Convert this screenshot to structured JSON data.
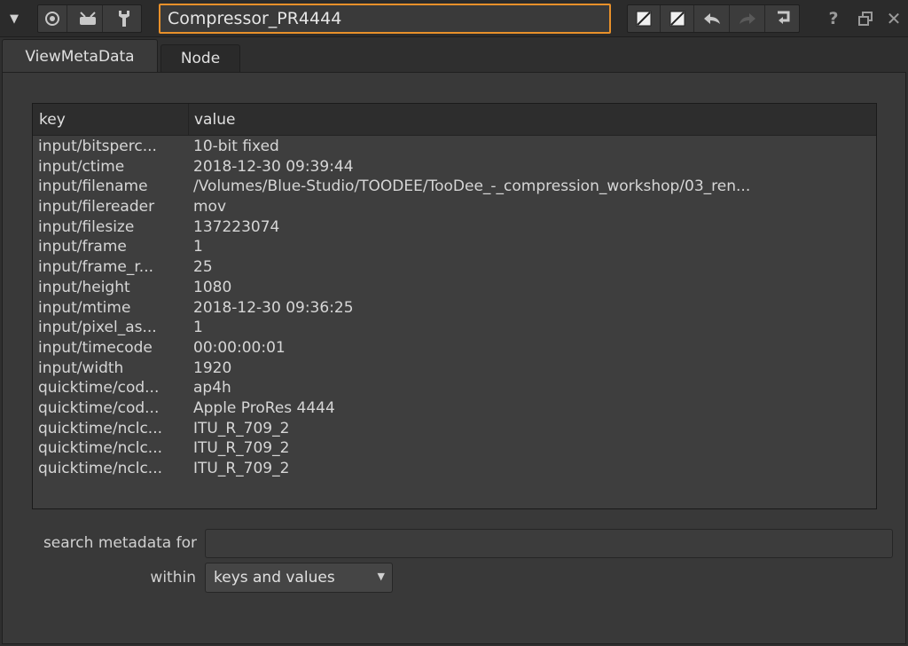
{
  "titlebar": {
    "node_name": "Compressor_PR4444",
    "collapse_icon": "triangle-down-icon",
    "left_tools": [
      "center-dot-icon",
      "viewer-icon",
      "settings-icon"
    ],
    "right_tools": [
      "input-swatch-icon",
      "output-swatch-icon",
      "undo-icon",
      "redo-icon",
      "revert-icon"
    ],
    "help_label": "?",
    "float_icon": "float-window-icon",
    "close_label": "✕"
  },
  "tabs": [
    {
      "label": "ViewMetaData",
      "active": true
    },
    {
      "label": "Node",
      "active": false
    }
  ],
  "table": {
    "headers": {
      "key": "key",
      "value": "value"
    },
    "rows": [
      {
        "key": "input/bitsperc...",
        "value": "10-bit fixed"
      },
      {
        "key": "input/ctime",
        "value": "2018-12-30 09:39:44"
      },
      {
        "key": "input/filename",
        "value": "/Volumes/Blue-Studio/TOODEE/TooDee_-_compression_workshop/03_ren..."
      },
      {
        "key": "input/filereader",
        "value": "mov"
      },
      {
        "key": "input/filesize",
        "value": "137223074"
      },
      {
        "key": "input/frame",
        "value": "1"
      },
      {
        "key": "input/frame_r...",
        "value": "25"
      },
      {
        "key": "input/height",
        "value": "1080"
      },
      {
        "key": "input/mtime",
        "value": "2018-12-30 09:36:25"
      },
      {
        "key": "input/pixel_as...",
        "value": "1"
      },
      {
        "key": "input/timecode",
        "value": "00:00:00:01"
      },
      {
        "key": "input/width",
        "value": "1920"
      },
      {
        "key": "quicktime/cod...",
        "value": "ap4h"
      },
      {
        "key": "quicktime/cod...",
        "value": "Apple ProRes 4444"
      },
      {
        "key": "quicktime/nclc...",
        "value": "ITU_R_709_2"
      },
      {
        "key": "quicktime/nclc...",
        "value": "ITU_R_709_2"
      },
      {
        "key": "quicktime/nclc...",
        "value": "ITU_R_709_2"
      }
    ]
  },
  "search": {
    "label": "search metadata for",
    "value": "",
    "within_label": "within",
    "within_value": "keys and values"
  },
  "colors": {
    "accent": "#e8902a"
  }
}
